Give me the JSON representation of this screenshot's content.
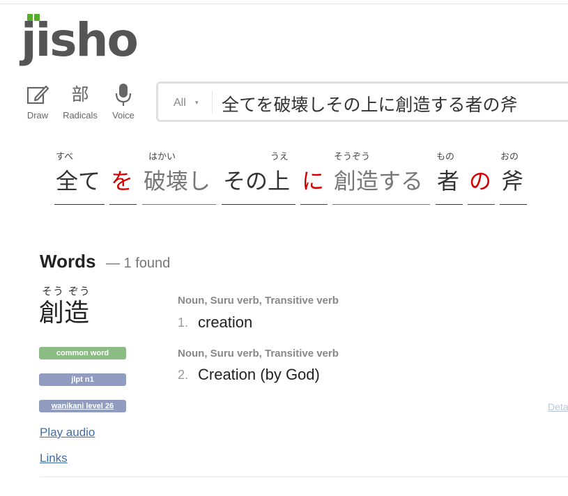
{
  "logo": {
    "text": "jisho"
  },
  "tools": [
    {
      "label": "Draw",
      "icon": "pencil-icon"
    },
    {
      "label": "Radicals",
      "glyph": "部",
      "icon": "radicals-icon"
    },
    {
      "label": "Voice",
      "icon": "microphone-icon"
    }
  ],
  "search": {
    "scope": "All",
    "scope_caret": "▾",
    "value": "全てを破壊しその上に創造する者の斧"
  },
  "sentence": [
    {
      "furigana": "すべ",
      "text": "全て",
      "kind": "word"
    },
    {
      "furigana": "",
      "text": "を",
      "kind": "particle"
    },
    {
      "furigana": "はかい",
      "text": "破壊し",
      "kind": "light"
    },
    {
      "furigana": "うえ",
      "text": "その上",
      "kind": "word"
    },
    {
      "furigana": "",
      "text": "に",
      "kind": "particle"
    },
    {
      "furigana": "そうぞう",
      "text": "創造する",
      "kind": "light"
    },
    {
      "furigana": "もの",
      "text": "者",
      "kind": "word"
    },
    {
      "furigana": "",
      "text": "の",
      "kind": "particle"
    },
    {
      "furigana": "おの",
      "text": "斧",
      "kind": "word"
    }
  ],
  "words": {
    "title": "Words",
    "count": "— 1 found"
  },
  "entry": {
    "furigana": "そう ぞう",
    "word": "創造",
    "badges": {
      "common": "common word",
      "jlpt": "jlpt n1",
      "wanikani": "wanikani level 26"
    },
    "links": {
      "audio": "Play audio",
      "links": "Links"
    },
    "senses": [
      {
        "tags": "Noun, Suru verb, Transitive verb",
        "num": "1.",
        "text": "creation"
      },
      {
        "tags": "Noun, Suru verb, Transitive verb",
        "num": "2.",
        "text": "Creation (by God)"
      }
    ],
    "details": "Details ▸"
  },
  "colors": {
    "brand_green": "#56ad2c",
    "particle_red": "#d30000",
    "link_blue": "#3f6da8",
    "badge_common": "#8abc83",
    "badge_tag": "#909dc0"
  }
}
